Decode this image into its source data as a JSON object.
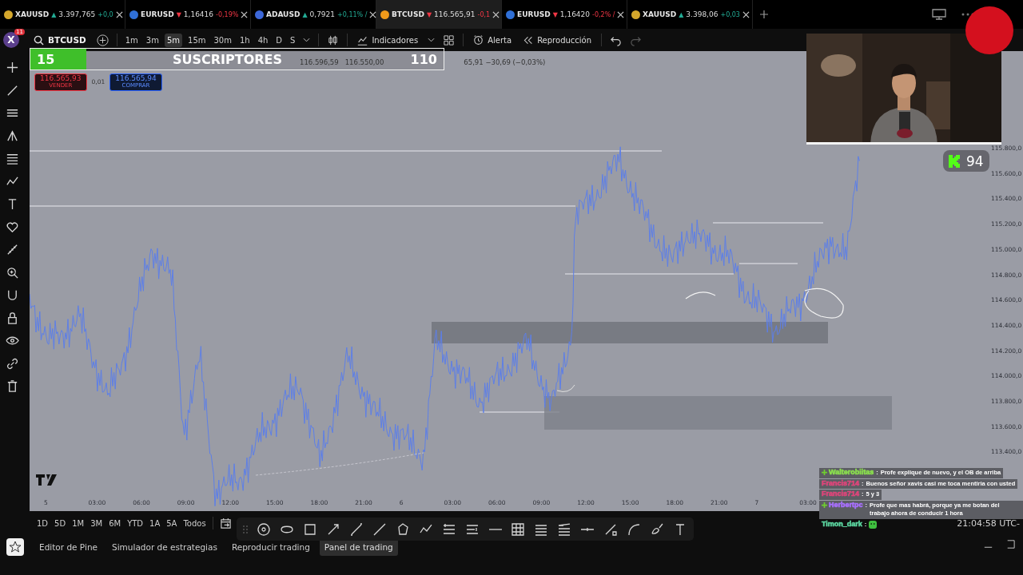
{
  "tabs": [
    {
      "symbol": "XAUUSD",
      "color": "#d4a72c",
      "arrow": "▲",
      "rising": true,
      "price": "3.397,765",
      "change": "+0,0",
      "selected": false
    },
    {
      "symbol": "EURUSD",
      "color": "#2f6fd6",
      "arrow": "▼",
      "rising": false,
      "price": "1,16416",
      "change": "-0,19%",
      "selected": false
    },
    {
      "symbol": "ADAUSD",
      "color": "#3c67d9",
      "arrow": "▲",
      "rising": true,
      "price": "0,7921",
      "change": "+0,11% /",
      "selected": false
    },
    {
      "symbol": "BTCUSD",
      "color": "#f09a1a",
      "arrow": "▼",
      "rising": false,
      "price": "116.565,91",
      "change": "-0,1",
      "selected": true
    },
    {
      "symbol": "EURUSD",
      "color": "#2f6fd6",
      "arrow": "▼",
      "rising": false,
      "price": "1,16420",
      "change": "-0,2% /",
      "selected": false
    },
    {
      "symbol": "XAUUSD",
      "color": "#d4a72c",
      "arrow": "▲",
      "rising": true,
      "price": "3.398,06",
      "change": "+0,03",
      "selected": false
    }
  ],
  "toolbar": {
    "avatar": "X",
    "notifications": "11",
    "symbol": "BTCUSD",
    "intervals": [
      {
        "label": "1m",
        "selected": false
      },
      {
        "label": "3m",
        "selected": false
      },
      {
        "label": "5m",
        "selected": true
      },
      {
        "label": "15m",
        "selected": false
      },
      {
        "label": "30m",
        "selected": false
      },
      {
        "label": "1h",
        "selected": false
      },
      {
        "label": "4h",
        "selected": false
      },
      {
        "label": "D",
        "selected": false
      },
      {
        "label": "S",
        "selected": false
      }
    ],
    "indicators": "Indicadores",
    "alert": "Alerta",
    "replay": "Reproducción"
  },
  "subscriber_goal": {
    "current": "15",
    "label": "SUSCRIPTORES",
    "goal": "110",
    "level": 0.136
  },
  "ohlc": [
    "116.596,59",
    "116.550,00",
    "65,91 −30,69 (−0,03%)"
  ],
  "trade_buttons": [
    {
      "kind": "sell",
      "price": "116.565,93",
      "label": "VENDER"
    },
    {
      "kind": "spread",
      "price": "0,01"
    },
    {
      "kind": "buy",
      "price": "116.565,94",
      "label": "COMPRAR"
    }
  ],
  "price_axis": [
    "115.800,0",
    "115.600,0",
    "115.400,0",
    "115.200,0",
    "115.000,0",
    "114.800,0",
    "114.600,0",
    "114.400,0",
    "114.200,0",
    "114.000,0",
    "113.800,0",
    "113.600,0",
    "113.400,0"
  ],
  "time_axis": [
    "5",
    "03:00",
    "06:00",
    "09:00",
    "12:00",
    "15:00",
    "18:00",
    "21:00",
    "6",
    "03:00",
    "06:00",
    "09:00",
    "12:00",
    "15:00",
    "18:00",
    "21:00",
    "7",
    "03:00"
  ],
  "kick_viewers": "94",
  "chat": [
    {
      "user": "Walterobiitas",
      "color": "#8be04e",
      "separator": ":",
      "badge": true,
      "emote": false,
      "message": "Profe explique de nuevo, y el OB de arriba"
    },
    {
      "user": "Francis714",
      "color": "#e0457b",
      "separator": ":",
      "badge": false,
      "emote": false,
      "message": "Buenos señor xavis casi me toca mentiria con usted"
    },
    {
      "user": "Francis714",
      "color": "#e0457b",
      "separator": ":",
      "badge": false,
      "emote": false,
      "message": "5 y 3"
    },
    {
      "user": "Herbertpc",
      "color": "#a970ff",
      "separator": ":",
      "badge": true,
      "emote": false,
      "message": "Profe que mas habrá, porque ya me botan del trabajo ahora de conducir 1 hora"
    },
    {
      "user": "Timon_dark",
      "color": "#5cd6a0",
      "separator": ":",
      "badge": false,
      "emote": true
    }
  ],
  "ranges": [
    "1D",
    "5D",
    "1M",
    "3M",
    "6M",
    "YTD",
    "1A",
    "5A",
    "Todos"
  ],
  "clock": "21:04:58 UTC-",
  "panel_tabs": [
    {
      "label": "Editor de Pine",
      "selected": false
    },
    {
      "label": "Simulador de estrategias",
      "selected": false
    },
    {
      "label": "Reproducir trading",
      "selected": false
    },
    {
      "label": "Panel de trading",
      "selected": true
    }
  ]
}
